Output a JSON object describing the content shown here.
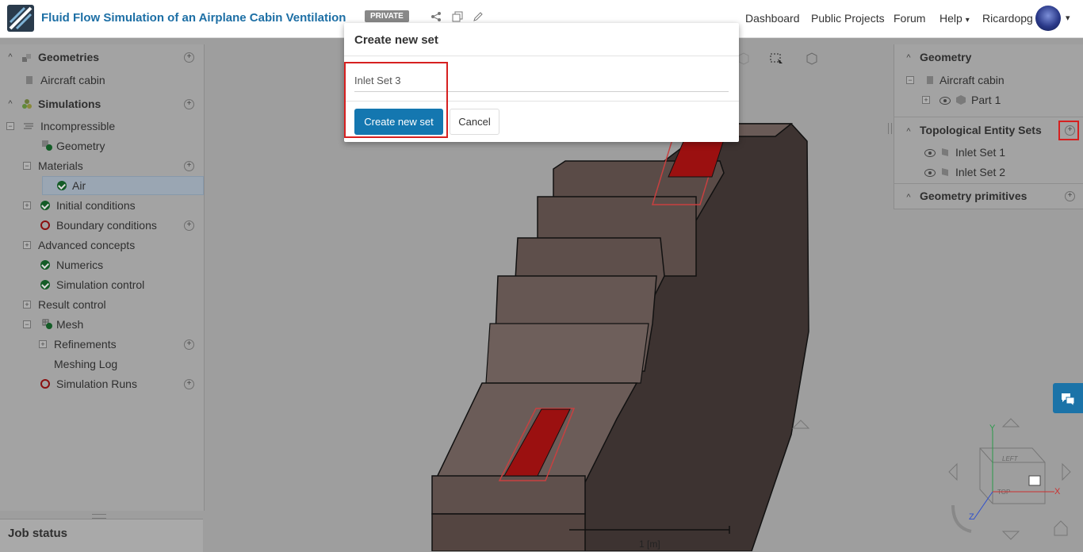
{
  "header": {
    "title": "Fluid Flow Simulation of an Airplane Cabin Ventilation",
    "badge": "PRIVATE",
    "nav": [
      "Dashboard",
      "Public Projects",
      "Forum",
      "Help",
      "Ricardopg"
    ]
  },
  "left_tree": {
    "geometries_label": "Geometries",
    "aircraft_cabin": "Aircraft cabin",
    "simulations_label": "Simulations",
    "incompressible": "Incompressible",
    "geometry": "Geometry",
    "materials": "Materials",
    "air": "Air",
    "initial_conditions": "Initial conditions",
    "boundary_conditions": "Boundary conditions",
    "advanced_concepts": "Advanced concepts",
    "numerics": "Numerics",
    "simulation_control": "Simulation control",
    "result_control": "Result control",
    "mesh": "Mesh",
    "refinements": "Refinements",
    "meshing_log": "Meshing Log",
    "simulation_runs": "Simulation Runs"
  },
  "job_status": "Job status",
  "right_panel": {
    "geometry_label": "Geometry",
    "aircraft_cabin": "Aircraft cabin",
    "part1": "Part 1",
    "tes_label": "Topological Entity Sets",
    "inlet_set_1": "Inlet Set 1",
    "inlet_set_2": "Inlet Set 2",
    "geometry_primitives": "Geometry primitives"
  },
  "viewport": {
    "scale_label": "1 [m]",
    "cube_left": "LEFT",
    "cube_top": "TOP",
    "axis_x": "X",
    "axis_y": "Y",
    "axis_z": "Z"
  },
  "modal": {
    "title": "Create new set",
    "input_value": "Inlet Set 3",
    "create_label": "Create new set",
    "cancel_label": "Cancel"
  },
  "colors": {
    "accent": "#1477b0",
    "title_blue": "#1d6fa5",
    "selection_red": "#9b1010",
    "highlight_red": "#d62020",
    "body_brown": "#5d4e4a"
  }
}
